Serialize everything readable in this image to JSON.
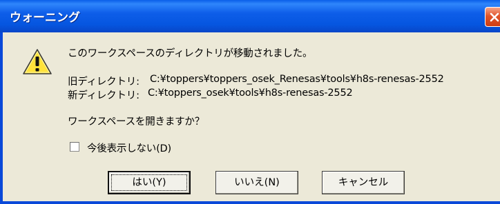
{
  "window": {
    "title": "ウォーニング"
  },
  "message": {
    "line1": "このワークスペースのディレクトリが移動されました。",
    "old_label": "旧ディレクトリ:",
    "old_path": "C:¥toppers¥toppers_osek_Renesas¥tools¥h8s-renesas-2552",
    "new_label": "新ディレクトリ:",
    "new_path": "C:¥toppers_osek¥tools¥h8s-renesas-2552",
    "question": "ワークスペースを開きますか？"
  },
  "checkbox": {
    "label": "今後表示しない(D)",
    "checked": false
  },
  "buttons": {
    "yes": "はい(Y)",
    "no": "いいえ(N)",
    "cancel": "キャンセル"
  },
  "icons": {
    "warning": "warning-icon",
    "close": "close-icon"
  }
}
